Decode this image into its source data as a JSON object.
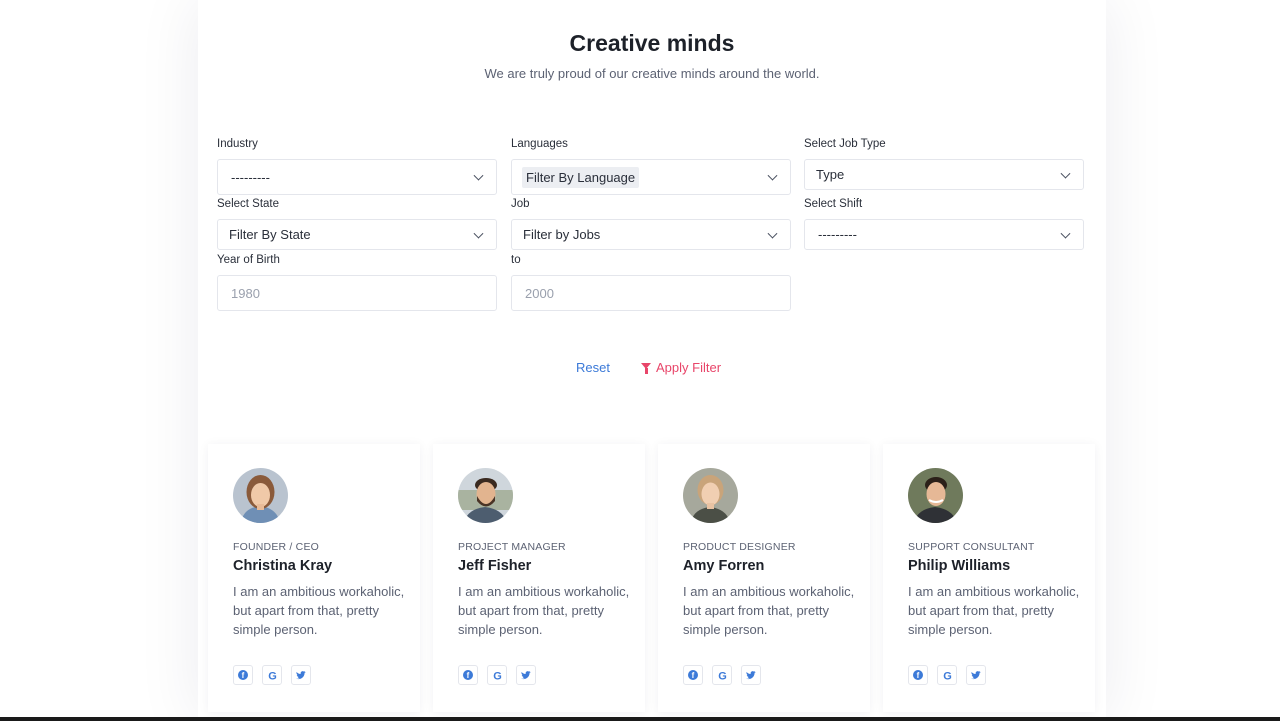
{
  "header": {
    "title": "Creative minds",
    "subtitle": "We are truly proud of our creative minds around the world."
  },
  "filters": {
    "industry": {
      "label": "Industry",
      "value": "---------"
    },
    "languages": {
      "label": "Languages",
      "value": "Filter By Language"
    },
    "job_type": {
      "label": "Select Job Type",
      "value": "Type"
    },
    "state": {
      "label": "Select State",
      "value": "Filter By State"
    },
    "job": {
      "label": "Job",
      "value": "Filter by Jobs"
    },
    "shift": {
      "label": "Select Shift",
      "value": "---------"
    },
    "year_from": {
      "label": "Year of Birth",
      "placeholder": "1980"
    },
    "year_to": {
      "label": "to",
      "placeholder": "2000"
    },
    "reset_label": "Reset",
    "apply_label": "Apply Filter"
  },
  "colors": {
    "link_blue": "#3c7ad8",
    "apply_pink": "#e8466a"
  },
  "team": [
    {
      "role": "FOUNDER / CEO",
      "name": "Christina Kray",
      "bio": "I am an ambitious workaholic, but apart from that, pretty simple person.",
      "socials": [
        "facebook-icon",
        "google-icon",
        "twitter-icon"
      ]
    },
    {
      "role": "PROJECT MANAGER",
      "name": "Jeff Fisher",
      "bio": "I am an ambitious workaholic, but apart from that, pretty simple person.",
      "socials": [
        "facebook-icon",
        "google-icon",
        "twitter-icon"
      ]
    },
    {
      "role": "PRODUCT DESIGNER",
      "name": "Amy Forren",
      "bio": "I am an ambitious workaholic, but apart from that, pretty simple person.",
      "socials": [
        "facebook-icon",
        "google-icon",
        "twitter-icon"
      ]
    },
    {
      "role": "SUPPORT CONSULTANT",
      "name": "Philip Williams",
      "bio": "I am an ambitious workaholic, but apart from that, pretty simple person.",
      "socials": [
        "facebook-icon",
        "google-icon",
        "twitter-icon"
      ]
    }
  ]
}
